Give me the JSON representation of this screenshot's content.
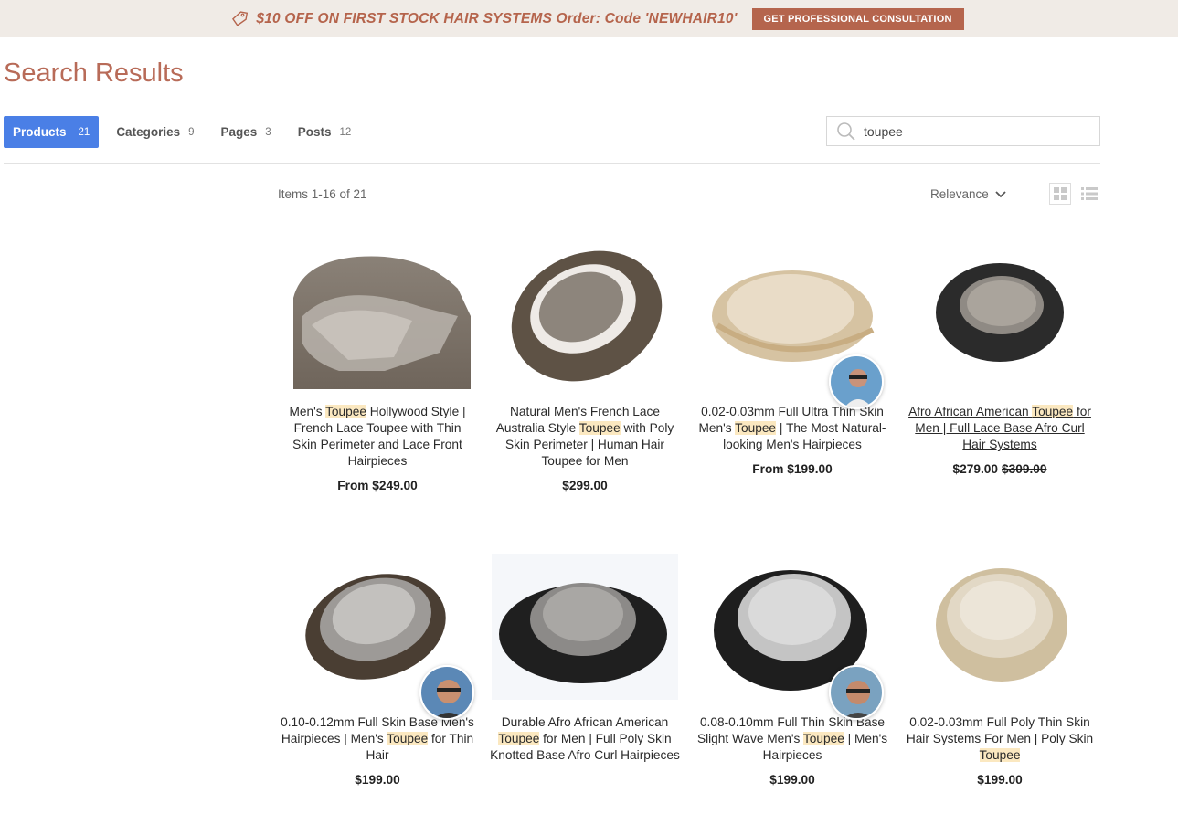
{
  "promo": {
    "text": "$10 OFF ON FIRST STOCK HAIR SYSTEMS Order: Code 'NEWHAIR10'",
    "button": "GET PROFESSIONAL CONSULTATION"
  },
  "page_title": "Search Results",
  "tabs": [
    {
      "label": "Products",
      "count": "21",
      "active": true
    },
    {
      "label": "Categories",
      "count": "9"
    },
    {
      "label": "Pages",
      "count": "3"
    },
    {
      "label": "Posts",
      "count": "12"
    }
  ],
  "search": {
    "value": "toupee"
  },
  "results": {
    "summary": "Items 1-16 of 21",
    "sort": "Relevance"
  },
  "products": [
    {
      "t1": "Men's ",
      "hl": "Toupee",
      "t2": " Hollywood Style | French Lace Toupee with Thin Skin Perimeter and Lace Front Hairpieces",
      "price": "From $249.00"
    },
    {
      "t1": "Natural Men's French Lace Australia Style ",
      "hl": "Toupee",
      "t2": " with Poly Skin Perimeter | Human Hair Toupee for Men",
      "price": "$299.00"
    },
    {
      "t1": "0.02-0.03mm Full Ultra Thin Skin Men's ",
      "hl": "Toupee",
      "t2": " | The Most Natural-looking Men's Hairpieces",
      "price": "From $199.00"
    },
    {
      "t1": "Afro African American ",
      "hl": "Toupee",
      "t2": " for Men | Full Lace Base Afro Curl Hair Systems",
      "price": "$279.00",
      "old_price": "$309.00"
    },
    {
      "t1": "0.10-0.12mm Full Skin Base Men's Hairpieces | Men's ",
      "hl": "Toupee",
      "t2": " for Thin Hair",
      "price": "$199.00"
    },
    {
      "t1": "Durable Afro African American ",
      "hl": "Toupee",
      "t2": " for Men | Full Poly Skin Knotted Base Afro Curl Hairpieces",
      "price": ""
    },
    {
      "t1": "0.08-0.10mm Full Thin Skin Base Slight Wave Men's ",
      "hl": "Toupee",
      "t2": " | Men's Hairpieces",
      "price": "$199.00"
    },
    {
      "t1": "0.02-0.03mm Full Poly Thin Skin Hair Systems For Men | Poly Skin ",
      "hl": "Toupee",
      "t2": "",
      "price": "$199.00"
    }
  ],
  "colors": {
    "accent": "#4a7fe6",
    "brand": "#b5654d",
    "highlight": "#fbe8c0"
  }
}
